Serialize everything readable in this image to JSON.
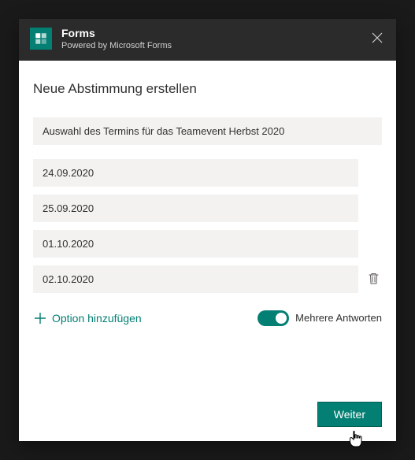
{
  "header": {
    "app_title": "Forms",
    "app_subtitle": "Powered by Microsoft Forms"
  },
  "page": {
    "title": "Neue Abstimmung erstellen",
    "question_value": "Auswahl des Termins für das Teamevent Herbst 2020"
  },
  "options": [
    {
      "value": "24.09.2020",
      "show_delete": false
    },
    {
      "value": "25.09.2020",
      "show_delete": false
    },
    {
      "value": "01.10.2020",
      "show_delete": false
    },
    {
      "value": "02.10.2020",
      "show_delete": true
    }
  ],
  "controls": {
    "add_option_label": "Option hinzufügen",
    "multi_label": "Mehrere Antworten",
    "multi_on": true
  },
  "footer": {
    "next_label": "Weiter"
  }
}
